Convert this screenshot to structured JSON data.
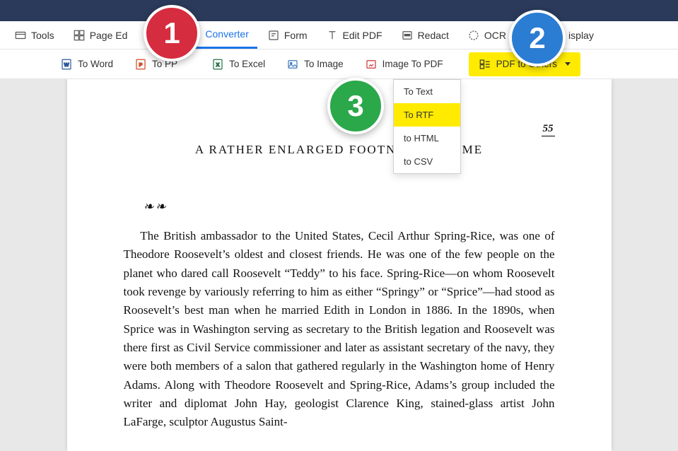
{
  "tabs": {
    "tools": "Tools",
    "page_edit": "Page Ed",
    "converter": "Converter",
    "form": "Form",
    "edit_pdf": "Edit PDF",
    "redact": "Redact",
    "ocr": "OCR",
    "display": "isplay"
  },
  "subtools": {
    "to_word": "To Word",
    "to_ppt": "To PP",
    "to_excel": "To Excel",
    "to_image": "To Image",
    "image_to_pdf": "Image To PDF",
    "pdf_to_others": "PDF to Others"
  },
  "dropdown": {
    "to_text": "To Text",
    "to_rtf": "To RTF",
    "to_html": "to HTML",
    "to_csv": "to CSV"
  },
  "callouts": {
    "one": "1",
    "two": "2",
    "three": "3"
  },
  "doc": {
    "page_num": "55",
    "title": "A RATHER ENLARGED FOOTNOTE IN TIME",
    "flourish": "❧❧",
    "paragraph": "The British ambassador to the United States, Cecil Arthur Spring-Rice, was one of Theodore Roosevelt’s oldest and closest friends. He was one of the few people on the planet who dared call Roosevelt “Teddy” to his face. Spring-Rice—on whom Roosevelt took revenge by variously referring to him as either “Springy” or “Sprice”—had stood as Roosevelt’s best man when he married Edith in London in 1886. In the 1890s, when Sprice was in Washington serving as secretary to the British legation and Roosevelt was there first as Civil Service commissioner and later as assistant secretary of the navy, they were both members of a salon that gathered regularly in the Washington home of Henry Adams. Along with Theodore Roosevelt and Spring-Rice, Adams’s group included the writer and diplomat John Hay, geologist Clarence King, stained-glass artist John LaFarge, sculptor Augustus Saint-"
  }
}
